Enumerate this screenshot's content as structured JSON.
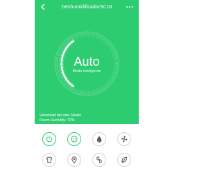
{
  "header": {
    "title": "Deshumidificador5C16",
    "back_icon": "chevron-left-icon",
    "more_icon": "more-dots-icon"
  },
  "dial": {
    "mode": "Auto",
    "mode_subtitle": "Modo inteligente"
  },
  "status": {
    "fan_speed": "Velocidad del aire: Medio",
    "room_humidity": "Room Humidity: 70%"
  },
  "controls": [
    {
      "name": "power",
      "icon": "power-icon"
    },
    {
      "name": "smart-mode",
      "icon": "smart-face-icon"
    },
    {
      "name": "dehumidify",
      "icon": "water-drop-icon"
    },
    {
      "name": "fan",
      "icon": "fan-icon"
    },
    {
      "name": "laundry",
      "icon": "shirt-icon"
    },
    {
      "name": "location",
      "icon": "location-pin-icon"
    },
    {
      "name": "sleep",
      "icon": "sleep-icon"
    },
    {
      "name": "eco",
      "icon": "leaf-icon"
    }
  ],
  "colors": {
    "accent": "#2ecc71",
    "icon": "#555555"
  }
}
